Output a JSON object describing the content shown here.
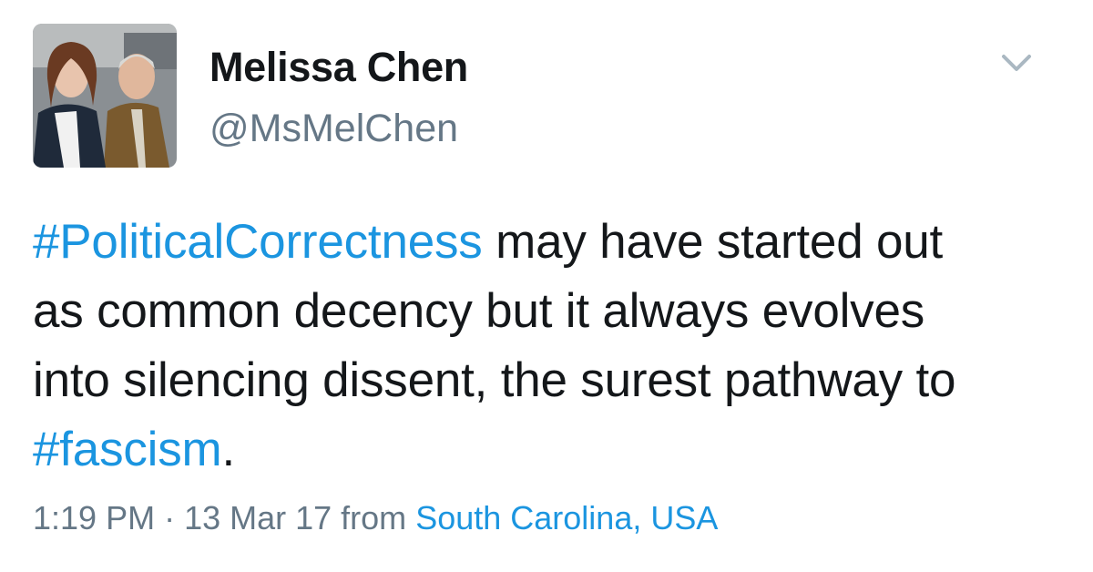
{
  "author": {
    "name": "Melissa Chen",
    "handle": "@MsMelChen"
  },
  "tweet": {
    "lines": [
      {
        "hashtag": "#PoliticalCorrectness",
        "text": " may have started out"
      },
      {
        "text": "as common decency but it always evolves"
      },
      {
        "text": "into silencing dissent, the surest pathway to"
      },
      {
        "hashtag": "#fascism",
        "text": "."
      }
    ]
  },
  "meta": {
    "time": "1:19 PM",
    "separator": " · ",
    "date": "13 Mar 17",
    "from_label": " from ",
    "location": "South Carolina, USA"
  },
  "icons": {
    "menu": "chevron-down-icon"
  },
  "colors": {
    "link": "#1b95e0",
    "secondary_text": "#657786",
    "primary_text": "#14171a"
  }
}
